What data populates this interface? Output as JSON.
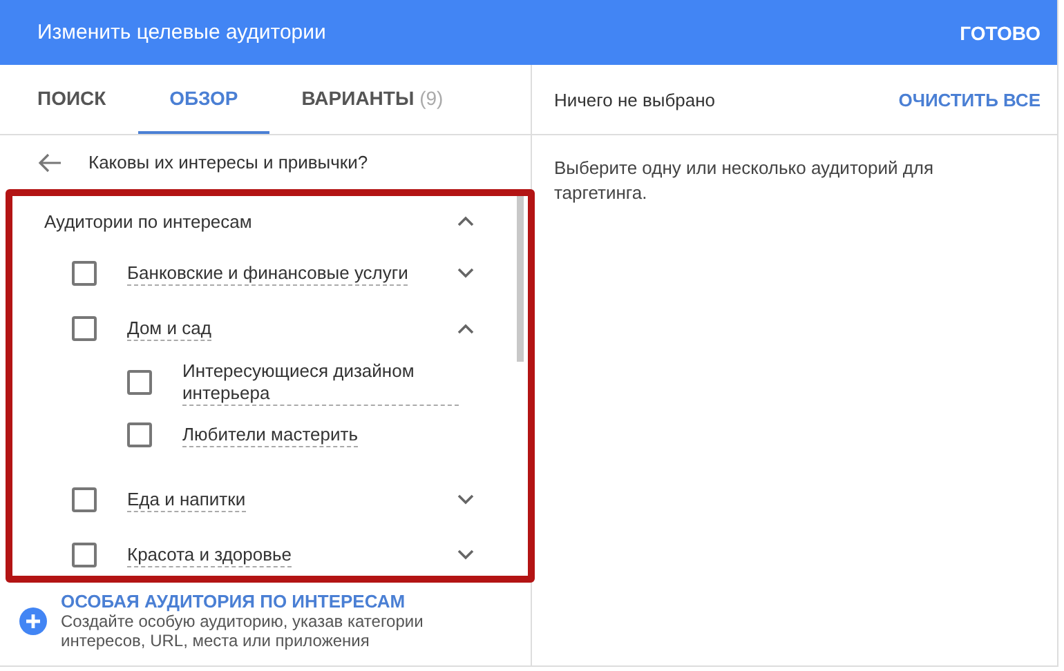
{
  "header": {
    "title": "Изменить целевые аудитории",
    "done_button": "ГОТОВО"
  },
  "tabs": [
    {
      "label": "ПОИСК",
      "selected": false
    },
    {
      "label": "ОБЗОР",
      "selected": true
    },
    {
      "label": "ВАРИАНТЫ",
      "count": "(9)",
      "selected": false
    }
  ],
  "question": "Каковы их интересы и привычки?",
  "tree": {
    "highlighted": true,
    "label": "Аудитории по интересам",
    "expanded": true,
    "children": [
      {
        "label": "Банковские и финансовые услуги",
        "checked": false,
        "expanded": false
      },
      {
        "label": "Дом и сад",
        "checked": false,
        "expanded": true,
        "children": [
          {
            "label": "Интересующиеся дизайном интерьера",
            "checked": false
          },
          {
            "label": "Любители мастерить",
            "checked": false
          }
        ]
      },
      {
        "label": "Еда и напитки",
        "checked": false,
        "expanded": false
      },
      {
        "label": "Красота и здоровье",
        "checked": false,
        "expanded": false
      }
    ]
  },
  "custom_audience": {
    "title": "ОСОБАЯ АУДИТОРИЯ ПО ИНТЕРЕСАМ",
    "description": "Создайте особую аудиторию, указав категории интересов, URL, места или приложения"
  },
  "selection": {
    "status": "Ничего не выбрано",
    "clear_button": "ОЧИСТИТЬ ВСЕ",
    "hint": "Выберите одну или несколько аудиторий для таргетинга."
  }
}
